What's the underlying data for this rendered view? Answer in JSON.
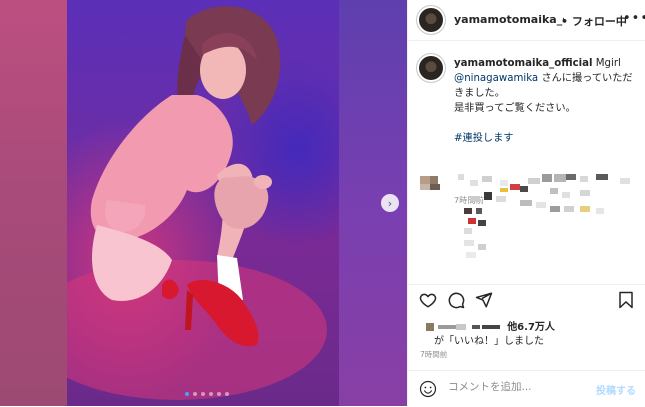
{
  "post": {
    "username": "yamamotomaika_offi",
    "follow_dot": "•",
    "follow_label": "フォロー中",
    "more_label": "•••",
    "caption_user": "yamamotomaika_official",
    "caption_line1": "Mgirl",
    "mention": "@ninagawamika",
    "caption_line2": "さんに撮っていただきました。",
    "caption_line3": "是非買ってご覧ください。",
    "hashtag": "#連投します",
    "caption_time": "7時間前",
    "likes_count": "他6.7万人",
    "likes_suffix": "が「いいね！」しました",
    "post_time": "7時間前",
    "comment_placeholder": "コメントを追加...",
    "post_button": "投稿する"
  },
  "carousel": {
    "total": 6,
    "active_index": 0
  },
  "colors": {
    "link": "#00376b",
    "post_button_disabled": "#b3dbff",
    "active_dot": "#4aa0ff"
  },
  "icons": [
    "next-arrow-icon",
    "heart-icon",
    "comment-icon",
    "share-icon",
    "bookmark-icon",
    "emoji-icon",
    "more-icon"
  ]
}
